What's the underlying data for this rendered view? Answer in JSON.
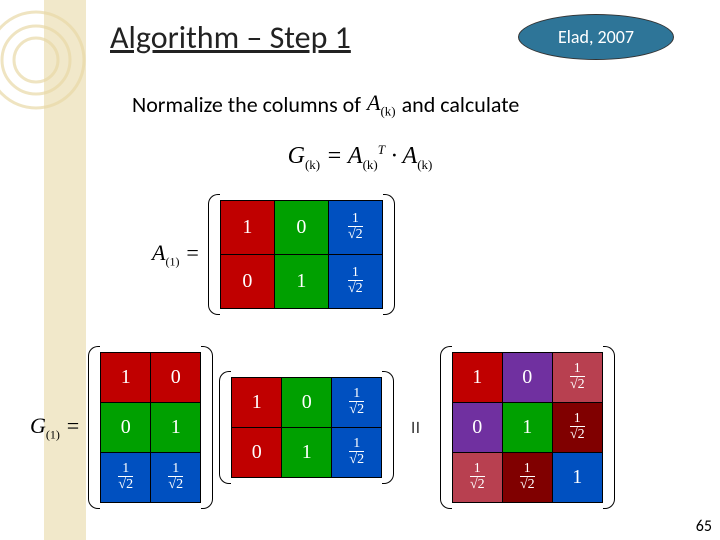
{
  "title": "Algorithm – Step 1",
  "badge": "Elad, 2007",
  "sentence": {
    "part1": "Normalize the columns of",
    "var": "A",
    "sub": "(k)",
    "part2": "and calculate"
  },
  "equation_center": "G<sub>(k)</sub> = A<sub>(k)</sub><sup>T</sup> · A<sub>(k)</sub>",
  "label_A1": {
    "var": "A",
    "sub": "(1)",
    "after": " ="
  },
  "label_G1": {
    "var": "G",
    "sub": "(1)",
    "after": " ="
  },
  "slide_number": "65",
  "matrix_A_top": {
    "rows": [
      [
        {
          "v": "1",
          "c": "c-red"
        },
        {
          "v": "0",
          "c": "c-green"
        },
        {
          "v": "frac",
          "c": "c-blue"
        }
      ],
      [
        {
          "v": "0",
          "c": "c-red"
        },
        {
          "v": "1",
          "c": "c-green"
        },
        {
          "v": "frac",
          "c": "c-blue"
        }
      ]
    ]
  },
  "matrix_G_left": {
    "rows": [
      [
        {
          "v": "1",
          "c": "c-red"
        },
        {
          "v": "0",
          "c": "c-red"
        }
      ],
      [
        {
          "v": "0",
          "c": "c-green"
        },
        {
          "v": "1",
          "c": "c-green"
        }
      ],
      [
        {
          "v": "frac",
          "c": "c-blue"
        },
        {
          "v": "frac",
          "c": "c-blue"
        }
      ]
    ]
  },
  "matrix_A_mid": {
    "rows": [
      [
        {
          "v": "1",
          "c": "c-red"
        },
        {
          "v": "0",
          "c": "c-green"
        },
        {
          "v": "frac",
          "c": "c-blue"
        }
      ],
      [
        {
          "v": "0",
          "c": "c-red"
        },
        {
          "v": "1",
          "c": "c-green"
        },
        {
          "v": "frac",
          "c": "c-blue"
        }
      ]
    ]
  },
  "matrix_G_right": {
    "rows": [
      [
        {
          "v": "1",
          "c": "c-red"
        },
        {
          "v": "0",
          "c": "c-purple"
        },
        {
          "v": "frac",
          "c": "c-pink"
        }
      ],
      [
        {
          "v": "0",
          "c": "c-purple"
        },
        {
          "v": "1",
          "c": "c-green"
        },
        {
          "v": "frac",
          "c": "c-maroon"
        }
      ],
      [
        {
          "v": "frac",
          "c": "c-pink"
        },
        {
          "v": "frac",
          "c": "c-maroon"
        },
        {
          "v": "1",
          "c": "c-blue"
        }
      ]
    ]
  },
  "frac": {
    "num": "1",
    "den": "√2"
  }
}
